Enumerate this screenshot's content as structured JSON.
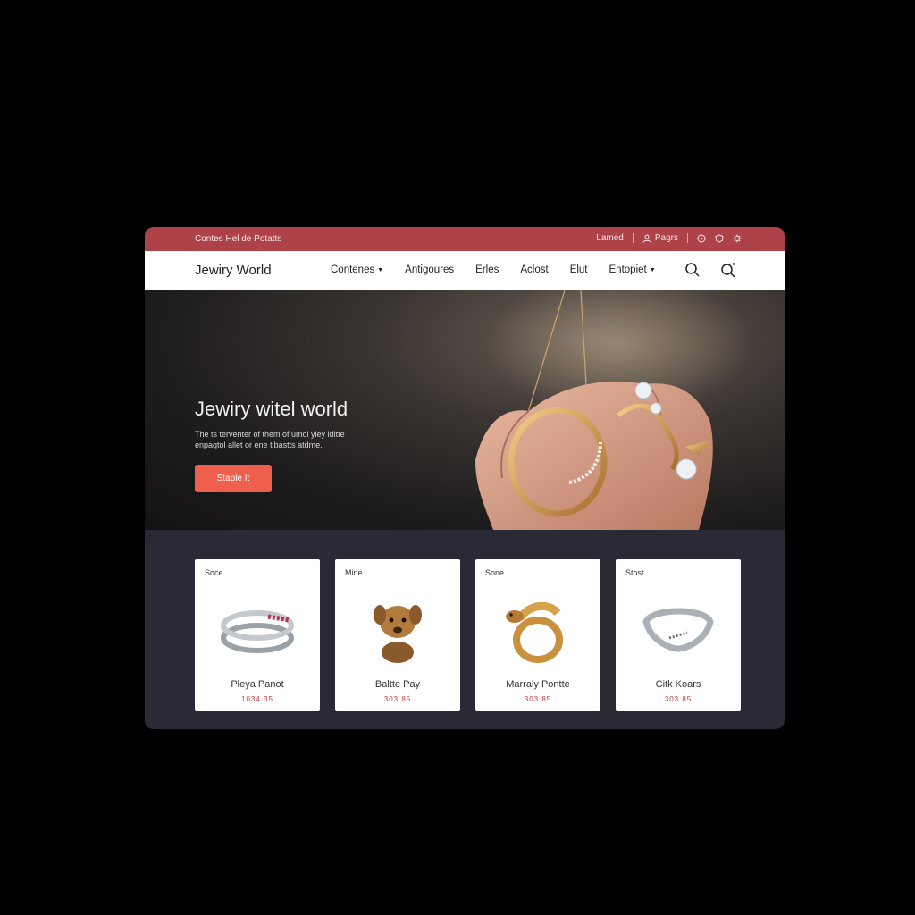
{
  "topbar": {
    "promo": "Contes  Hel de Potatts",
    "link1": "Lamed",
    "user_label": "Pagrs"
  },
  "nav": {
    "brand": "Jewiry World",
    "items": [
      {
        "label": "Contenes",
        "dropdown": true
      },
      {
        "label": "Antigoures",
        "dropdown": false
      },
      {
        "label": "Erles",
        "dropdown": false
      },
      {
        "label": "Aclost",
        "dropdown": false
      },
      {
        "label": "Elut",
        "dropdown": false
      },
      {
        "label": "Entopiet",
        "dropdown": true
      }
    ]
  },
  "hero": {
    "title": "Jewiry witel world",
    "subtitle": "The ts terventer of them of umol yley lditte enpagtol allet or ene tibastts atdme.",
    "button": "Staple It"
  },
  "products": [
    {
      "tag": "Soce",
      "name": "Pleya Panot",
      "price": "1034 35",
      "image": "silver-ruby-ring"
    },
    {
      "tag": "Mine",
      "name": "Baltte Pay",
      "price": "303 85",
      "image": "gold-dog-figurine"
    },
    {
      "tag": "Sone",
      "name": "Marraly Pontte",
      "price": "303 85",
      "image": "gold-serpent-ring"
    },
    {
      "tag": "Stost",
      "name": "Citk Koars",
      "price": "303 85",
      "image": "silver-wave-ring"
    }
  ],
  "colors": {
    "topbar": "#ad4249",
    "accent_button": "#ef5f4e",
    "panel": "#2a2a37",
    "price": "#c0393b"
  },
  "icons": [
    "user-icon",
    "circle-icon",
    "shield-icon",
    "gear-icon",
    "search-icon",
    "search-alt-icon"
  ]
}
